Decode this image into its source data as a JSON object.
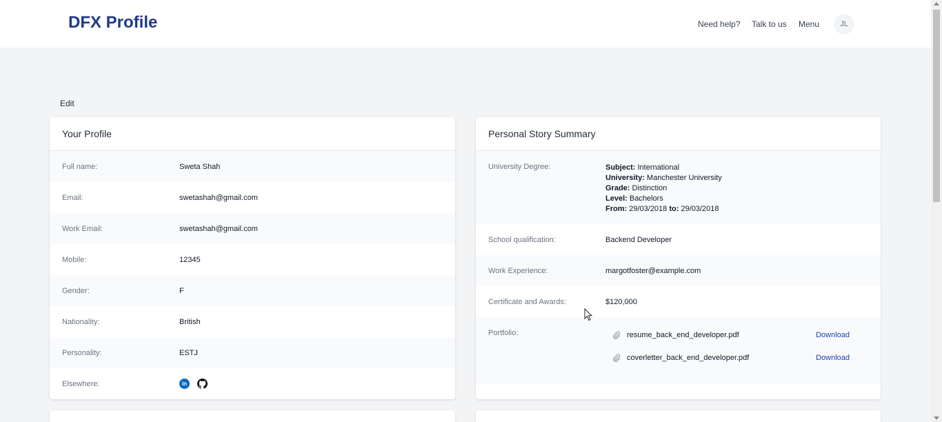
{
  "header": {
    "brand": "DFX Profile",
    "nav": {
      "help": "Need help?",
      "talk": "Talk to us",
      "menu": "Menu"
    },
    "avatar_initials": "JL"
  },
  "edit_label": "Edit",
  "profile": {
    "title": "Your Profile",
    "rows": [
      {
        "label": "Full name:",
        "value": "Sweta Shah"
      },
      {
        "label": "Email:",
        "value": "swetashah@gmail.com"
      },
      {
        "label": "Work Email:",
        "value": "swetashah@gmail.com"
      },
      {
        "label": "Mobile:",
        "value": "12345"
      },
      {
        "label": "Gender:",
        "value": "F"
      },
      {
        "label": "Nationality:",
        "value": "British"
      },
      {
        "label": "Personality:",
        "value": "ESTJ"
      },
      {
        "label": "Elsewhere:",
        "value": ""
      }
    ],
    "social": {
      "linkedin_glyph": "in",
      "icons": [
        "linkedin-icon",
        "github-icon"
      ]
    }
  },
  "story": {
    "title": "Personal Story Summary",
    "degree": {
      "label": "University Degree:",
      "subject_key": "Subject:",
      "subject": "International",
      "university_key": "University:",
      "university": "Manchester University",
      "grade_key": "Grade:",
      "grade": "Distinction",
      "level_key": "Level:",
      "level": "Bachelors",
      "from_key": "From:",
      "from": "29/03/2018",
      "to_key": "to:",
      "to": "29/03/2018"
    },
    "school": {
      "label": "School qualification:",
      "value": "Backend Developer"
    },
    "work": {
      "label": "Work Experience:",
      "value": "margotfoster@example.com"
    },
    "awards": {
      "label": "Certificate and Awards:",
      "value": "$120,000"
    },
    "portfolio": {
      "label": "Portfolio:",
      "files": [
        {
          "name": "resume_back_end_developer.pdf",
          "action": "Download"
        },
        {
          "name": "coverletter_back_end_developer.pdf",
          "action": "Download"
        }
      ]
    }
  },
  "colors": {
    "brand": "#1e3a8a",
    "link": "#1e40af",
    "linkedin": "#0a66c2",
    "page_bg": "#f3f4f6"
  }
}
